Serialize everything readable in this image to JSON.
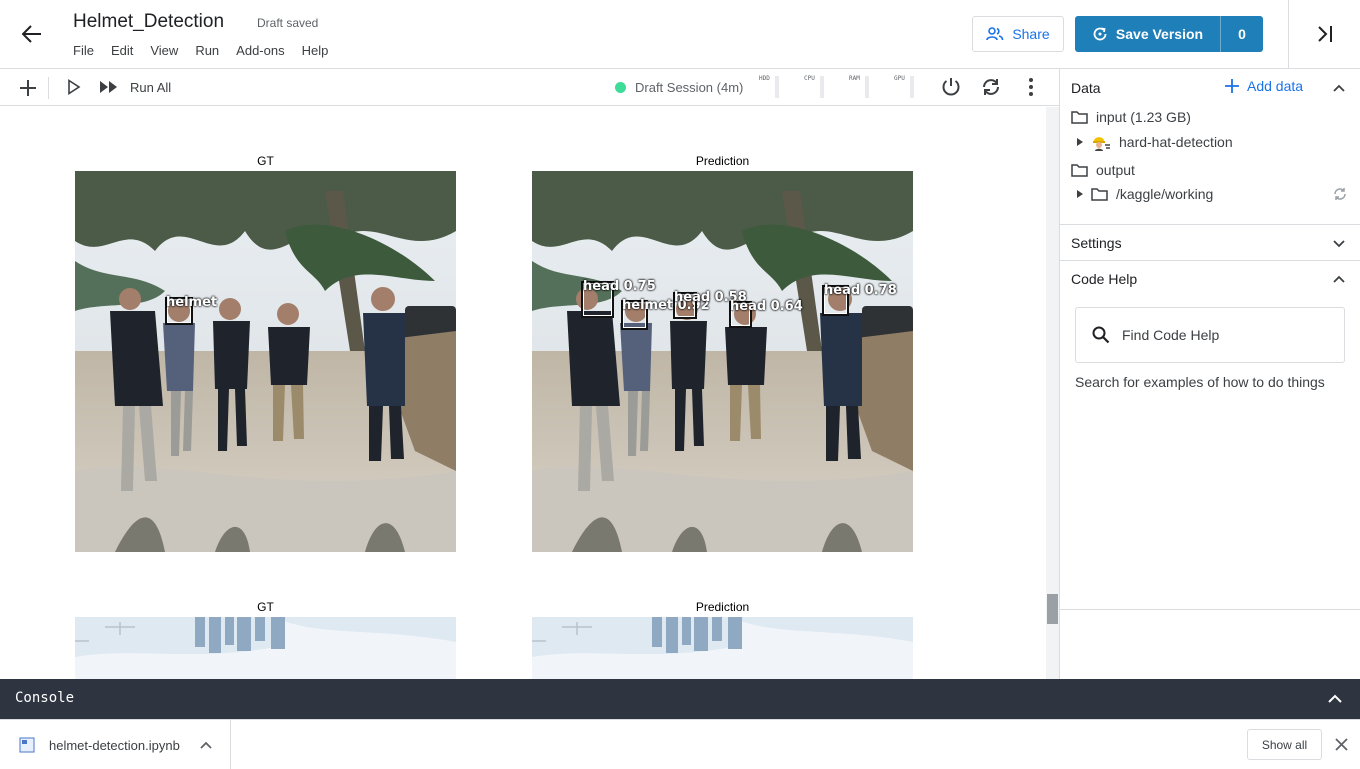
{
  "header": {
    "title": "Helmet_Detection",
    "status": "Draft saved",
    "menu": [
      "File",
      "Edit",
      "View",
      "Run",
      "Add-ons",
      "Help"
    ],
    "share_label": "Share",
    "save_label": "Save Version",
    "version_count": "0"
  },
  "toolbar": {
    "run_all_label": "Run All",
    "session_label": "Draft Session (4m)",
    "meters": [
      "HDD",
      "CPU",
      "RAM",
      "GPU"
    ]
  },
  "output": {
    "figures": [
      {
        "gt_title": "GT",
        "pred_title": "Prediction",
        "gt_boxes": [
          {
            "label": "helmet"
          }
        ],
        "pred_boxes": [
          {
            "label": "head 0.75"
          },
          {
            "label": "helmet 0.92"
          },
          {
            "label": "head 0.58"
          },
          {
            "label": "head 0.64"
          },
          {
            "label": "head 0.78"
          }
        ]
      },
      {
        "gt_title": "GT",
        "pred_title": "Prediction"
      }
    ]
  },
  "panel": {
    "data_title": "Data",
    "add_data_label": "Add data",
    "input_label": "input (1.23 GB)",
    "dataset_label": "hard-hat-detection",
    "output_label": "output",
    "working_label": "/kaggle/working",
    "settings_label": "Settings",
    "code_help_label": "Code Help",
    "find_help_placeholder": "Find Code Help",
    "help_desc": "Search for examples of how to do things"
  },
  "console": {
    "label": "Console"
  },
  "downloads": {
    "file_name": "helmet-detection.ipynb",
    "show_all_label": "Show all"
  },
  "colors": {
    "accent": "#1f7fb8",
    "link": "#1a73e8",
    "session_active": "#3ddc97",
    "console_bg": "#2e3440"
  }
}
